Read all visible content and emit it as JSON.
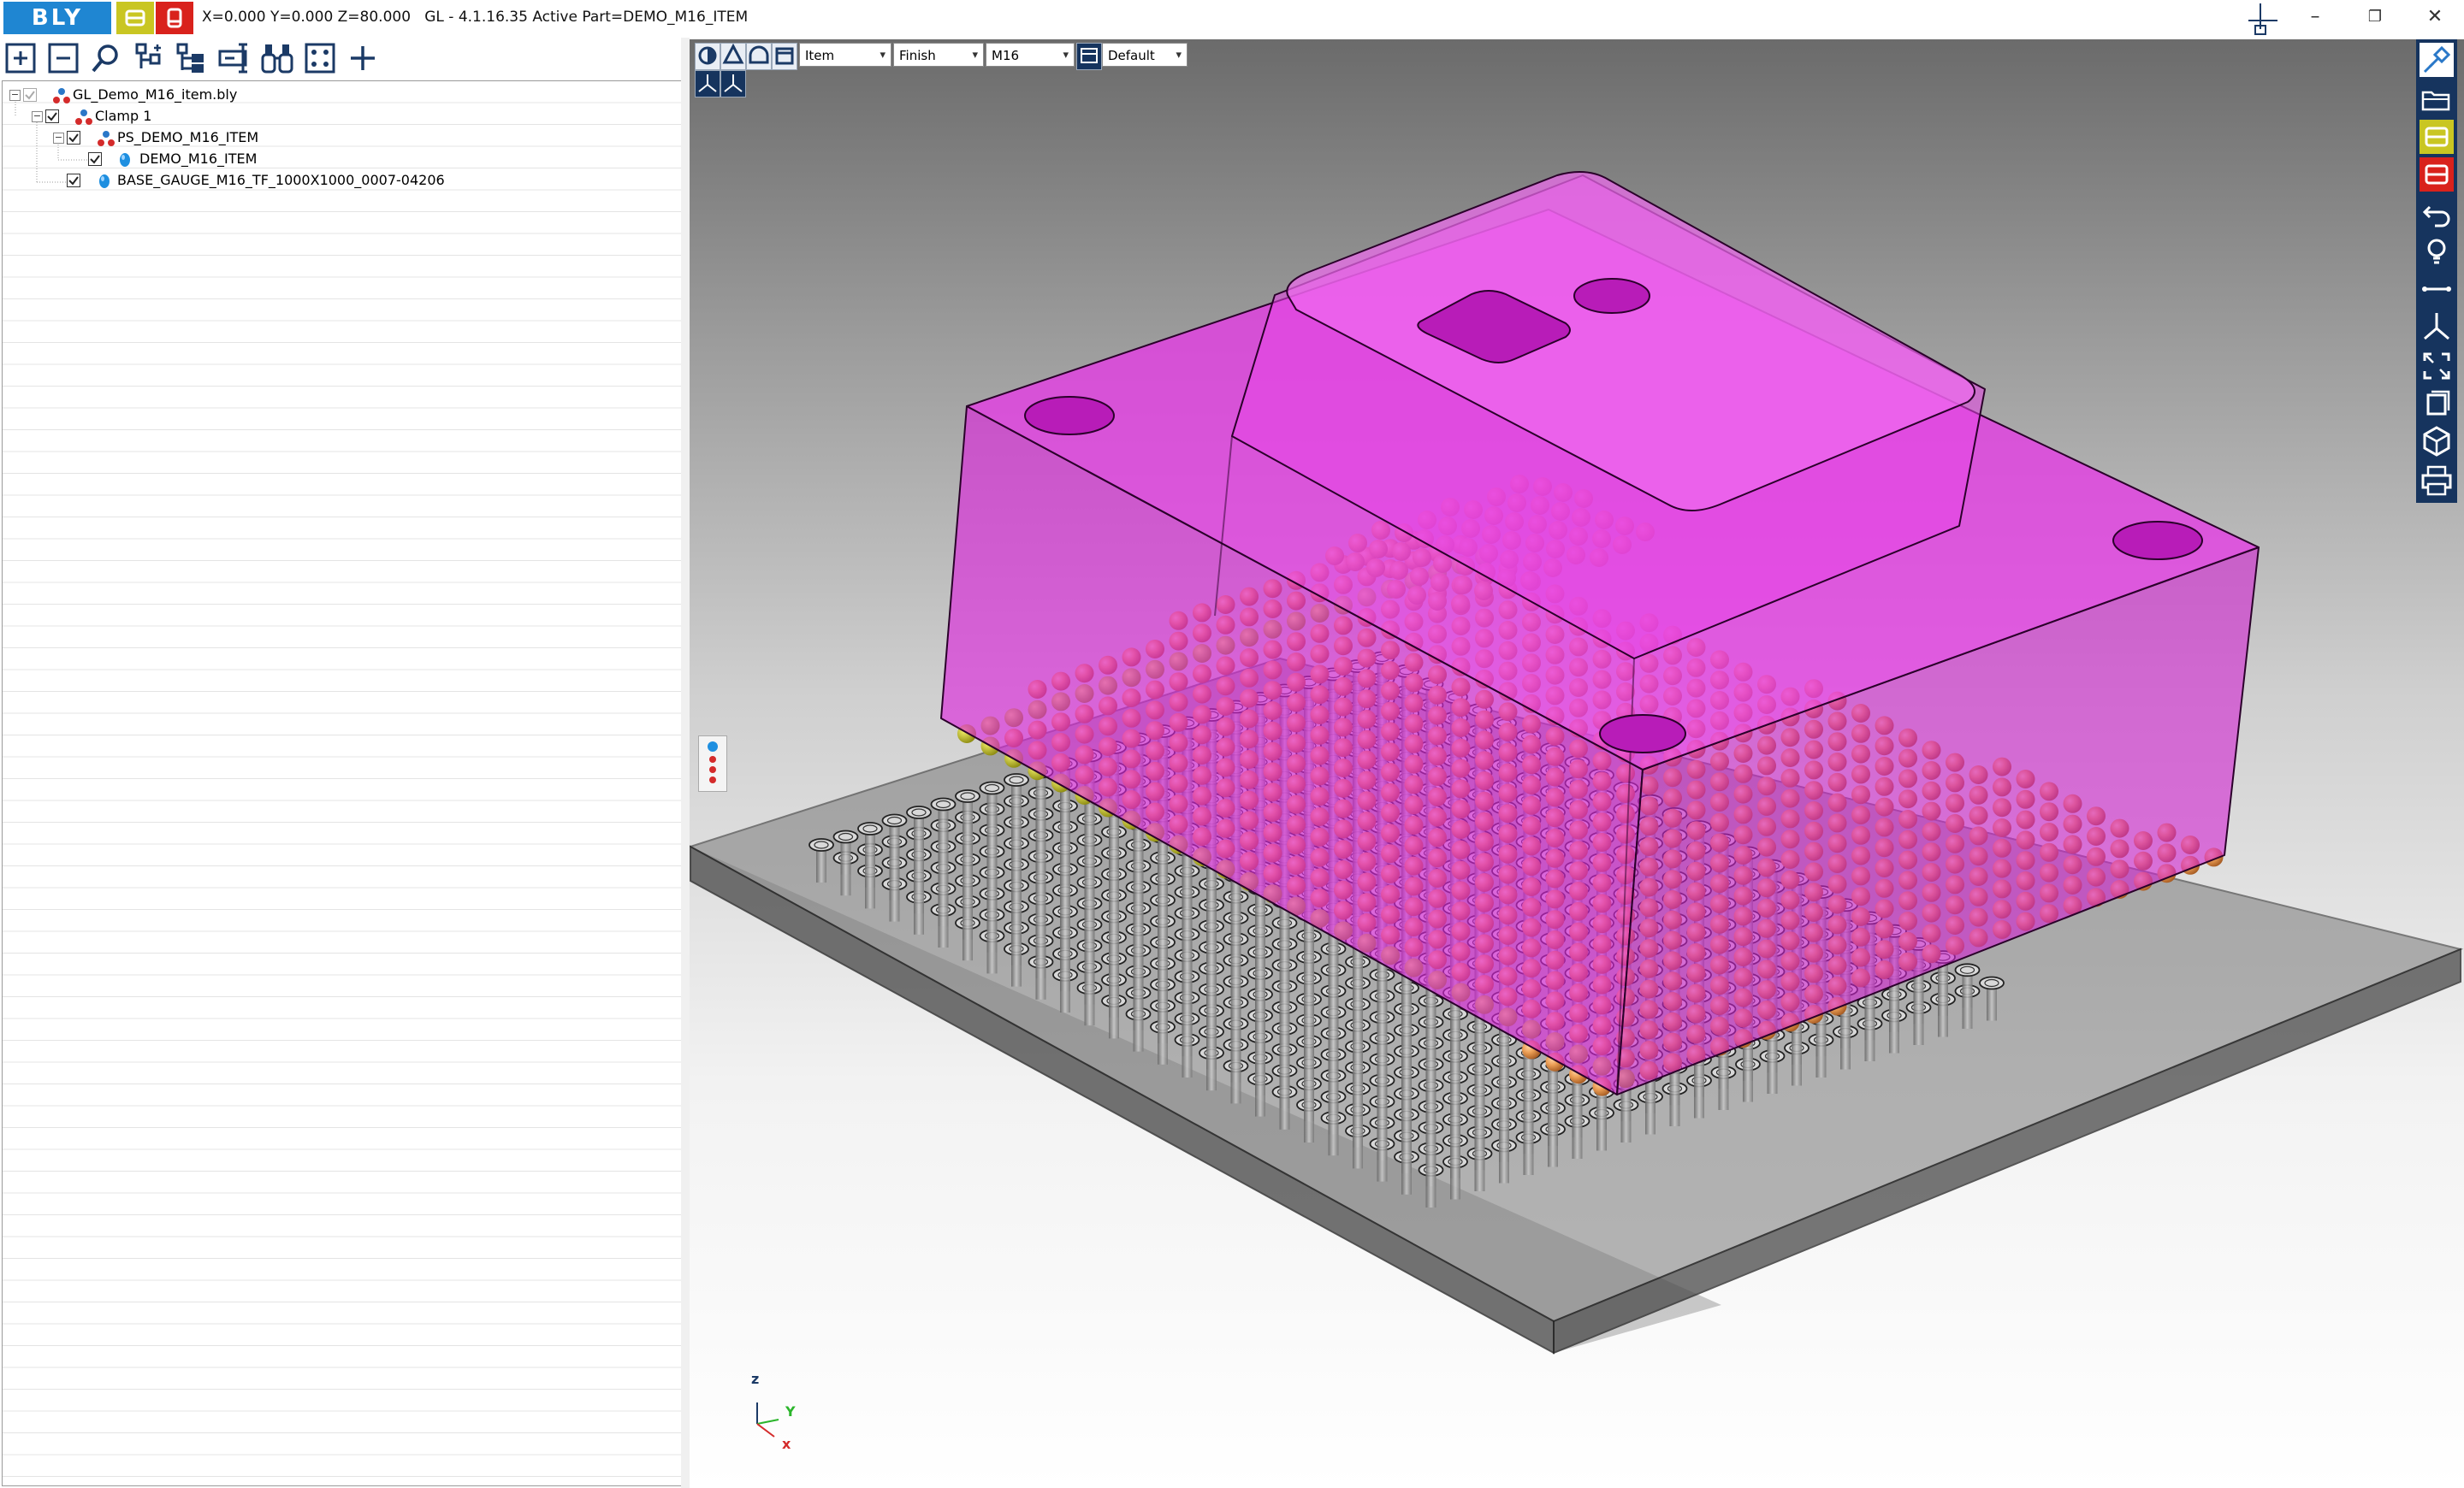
{
  "app": {
    "logo_text": "BLY",
    "title": "X=0.000 Y=0.000 Z=80.000   GL - 4.1.16.35 Active Part=DEMO_M16_ITEM",
    "window_controls": [
      "minimize-icon",
      "restore-icon",
      "close-icon"
    ],
    "window_symbols": {
      "minimize": "–",
      "restore": "❐",
      "close": "✕"
    }
  },
  "colors": {
    "brand_blue": "#1f86d2",
    "yellow_button": "#c9c622",
    "red_button": "#d9221c",
    "right_toolbar": "#16345e",
    "part_magenta": "#dd22dd",
    "sphere_orange": "#e39a52",
    "baseplate_gray": "#8c8c8c"
  },
  "toolbar": {
    "icons": [
      "expand-all-icon",
      "collapse-all-icon",
      "search-icon",
      "tree-add-icon",
      "tree-branch-icon",
      "rename-icon",
      "binoculars-icon",
      "fit-grid-icon",
      "add-icon"
    ]
  },
  "tree": {
    "items": [
      {
        "label": "GL_Demo_M16_item.bly",
        "level": 0,
        "checked": true,
        "icon": "assembly-icon"
      },
      {
        "label": "Clamp 1",
        "level": 1,
        "checked": true,
        "icon": "assembly-icon"
      },
      {
        "label": "PS_DEMO_M16_ITEM",
        "level": 2,
        "checked": true,
        "icon": "assembly-icon"
      },
      {
        "label": "DEMO_M16_ITEM",
        "level": 3,
        "checked": true,
        "icon": "part-icon"
      },
      {
        "label": "BASE_GAUGE_M16_TF_1000X1000_0007-04206",
        "level": 2,
        "checked": true,
        "icon": "part-icon"
      }
    ]
  },
  "viewport": {
    "view_icons": [
      "shaded-icon",
      "cone-icon",
      "arch-icon",
      "box-icon"
    ],
    "combos": [
      {
        "name": "item-combo",
        "value": "Item"
      },
      {
        "name": "finish-combo",
        "value": "Finish"
      },
      {
        "name": "size-combo",
        "value": "M16"
      },
      {
        "name": "default-combo",
        "value": "Default"
      }
    ],
    "axis": {
      "z": "z",
      "y": "Y",
      "x": "x"
    }
  },
  "right_toolbar": {
    "icons": [
      "pin-icon",
      "open-folder-icon",
      "yellow-part-icon",
      "red-part-icon",
      "undo-icon",
      "lightbulb-icon",
      "measure-icon",
      "axis-icon",
      "fit-view-icon",
      "copy-icon",
      "cube-icon",
      "print-icon"
    ]
  }
}
